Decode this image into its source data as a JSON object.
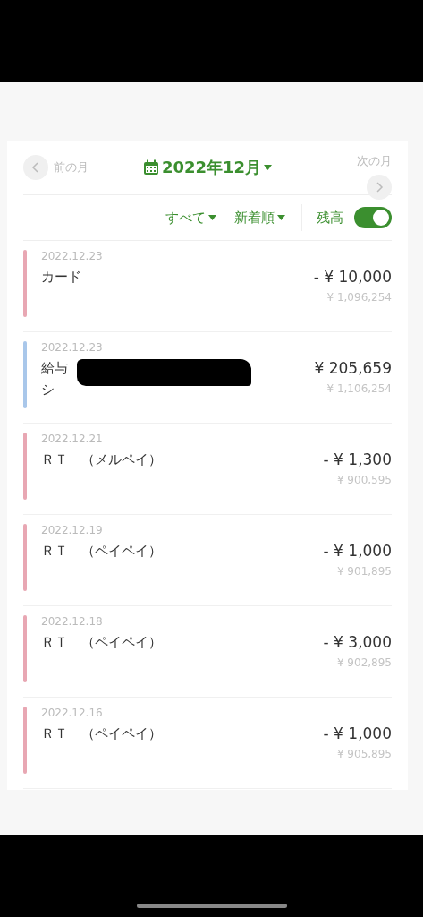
{
  "month_nav": {
    "prev": "前の月",
    "title": "2022年12月",
    "next": "次の月"
  },
  "filters": {
    "category": "すべて",
    "sort": "新着順",
    "balance_label": "残高",
    "balance_on": true
  },
  "transactions": [
    {
      "date": "2022.12.23",
      "title": "カード",
      "amount": "- ¥ 10,000",
      "balance": "¥ 1,096,254",
      "color": "#e8a7b3",
      "redacted": false
    },
    {
      "date": "2022.12.23",
      "title": "給与シ",
      "amount": "¥ 205,659",
      "balance": "¥ 1,106,254",
      "color": "#a9c7ea",
      "redacted": true
    },
    {
      "date": "2022.12.21",
      "title": "ＲＴ　（メルペイ）",
      "amount": "- ¥ 1,300",
      "balance": "¥ 900,595",
      "color": "#e8a7b3",
      "redacted": false
    },
    {
      "date": "2022.12.19",
      "title": "ＲＴ　（ペイペイ）",
      "amount": "- ¥ 1,000",
      "balance": "¥ 901,895",
      "color": "#e8a7b3",
      "redacted": false
    },
    {
      "date": "2022.12.18",
      "title": "ＲＴ　（ペイペイ）",
      "amount": "- ¥ 3,000",
      "balance": "¥ 902,895",
      "color": "#e8a7b3",
      "redacted": false
    },
    {
      "date": "2022.12.16",
      "title": "ＲＴ　（ペイペイ）",
      "amount": "- ¥ 1,000",
      "balance": "¥ 905,895",
      "color": "#e8a7b3",
      "redacted": false
    }
  ]
}
